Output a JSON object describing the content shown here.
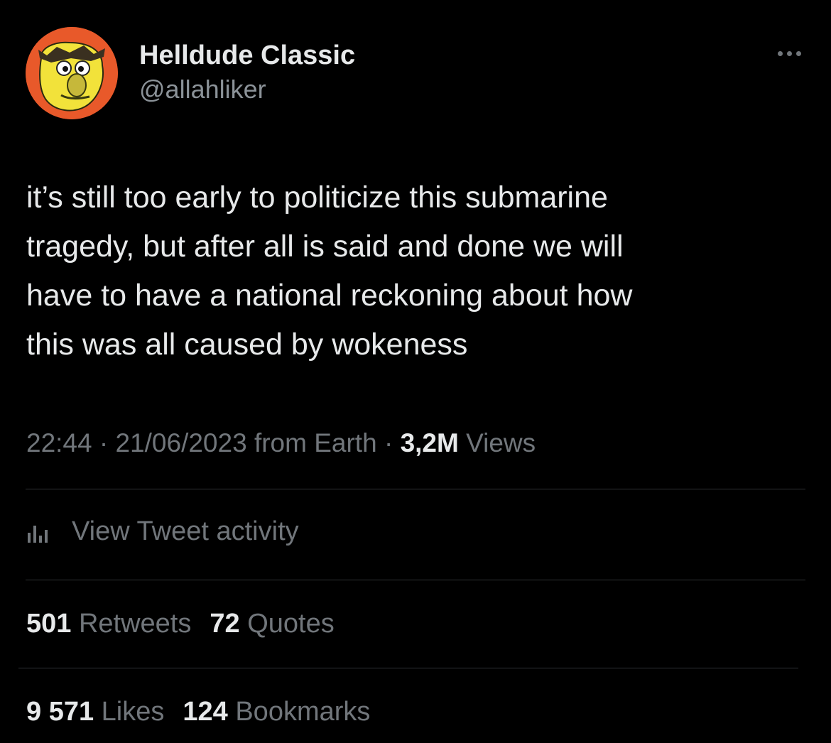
{
  "user": {
    "display_name": "Helldude Classic",
    "handle": "@allahliker"
  },
  "tweet": {
    "lines": [
      "it’s still too early to politicize this submarine",
      "tragedy, but after all is said and done we will",
      "have to have a national reckoning about how",
      "this was all caused by wokeness"
    ]
  },
  "meta": {
    "time": "22:44",
    "sep1": " · ",
    "date": "21/06/2023",
    "source": " from Earth",
    "sep2": " · ",
    "views_count": "3,2M",
    "views_label": " Views"
  },
  "activity": {
    "icon": "analytics-bar-icon",
    "label": "View Tweet activity"
  },
  "stats": {
    "retweets_count": "501",
    "retweets_label": " Retweets",
    "quotes_count": "72",
    "quotes_label": " Quotes",
    "likes_count": "9 571",
    "likes_label": " Likes",
    "bookmarks_count": "124",
    "bookmarks_label": " Bookmarks"
  },
  "colors": {
    "background": "#000000",
    "primary_text": "#e7e9ea",
    "secondary_text": "#71767b",
    "divider": "#2f3336",
    "avatar_background": "#e8592a",
    "avatar_face": "#f2e23a"
  }
}
